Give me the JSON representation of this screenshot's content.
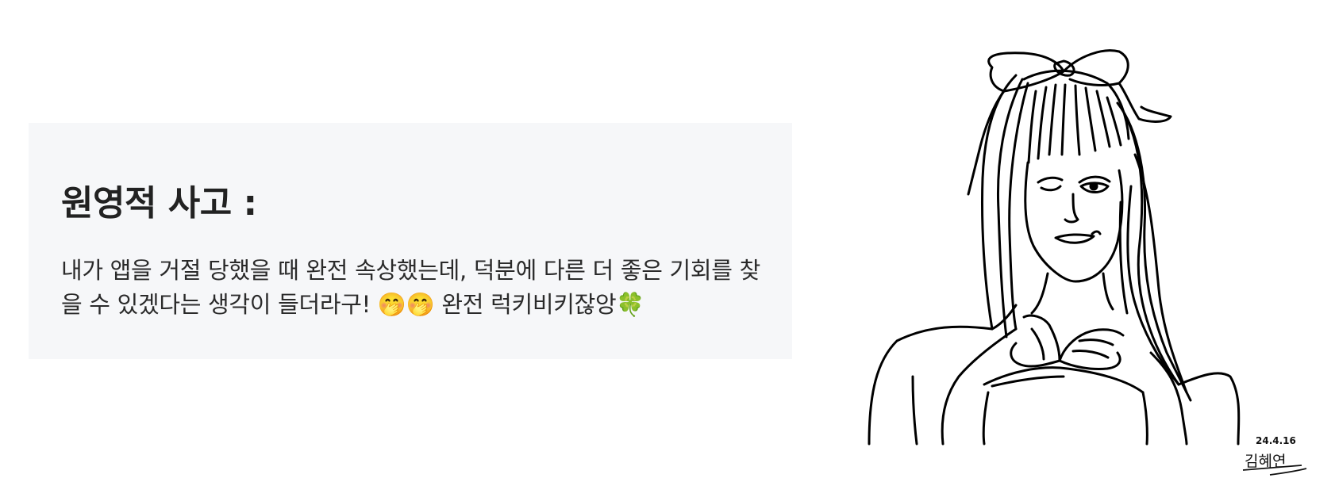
{
  "quote": {
    "title": "원영적 사고 :",
    "body": "내가 앱을 거절 당했을 때 완전 속상했는데, 덕분에 다른 더 좋은 기회를 찾을 수 있겠다는 생각이 들더라구! 🤭🤭 완전 럭키비키잖앙🍀"
  },
  "illustration": {
    "signature_date": "24.4.16",
    "signature_name": "김혜연"
  }
}
